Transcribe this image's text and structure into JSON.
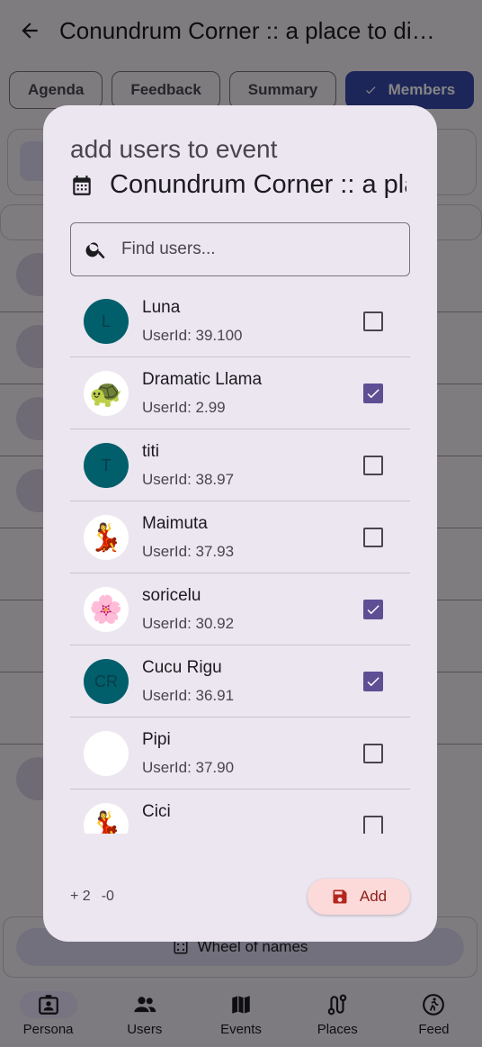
{
  "appbar": {
    "title": "Conundrum Corner :: a place to discuss"
  },
  "tabs": [
    {
      "label": "Agenda",
      "active": false
    },
    {
      "label": "Feedback",
      "active": false
    },
    {
      "label": "Summary",
      "active": false
    },
    {
      "label": "Members",
      "active": true
    }
  ],
  "background": {
    "wheel_label": "Wheel of names"
  },
  "nav": [
    {
      "label": "Persona",
      "icon": "persona-icon",
      "active": true
    },
    {
      "label": "Users",
      "icon": "users-icon",
      "active": false
    },
    {
      "label": "Events",
      "icon": "map-icon",
      "active": false
    },
    {
      "label": "Places",
      "icon": "route-icon",
      "active": false
    },
    {
      "label": "Feed",
      "icon": "run-icon",
      "active": false
    }
  ],
  "dialog": {
    "title": "add users to event",
    "subtitle": "Conundrum Corner :: a place to discuss",
    "search": {
      "placeholder": "Find users...",
      "value": ""
    },
    "users": [
      {
        "name": "Luna",
        "user_id": "UserId: 39.100",
        "avatar": "L",
        "checked": false
      },
      {
        "name": "Dramatic Llama",
        "user_id": "UserId: 2.99",
        "avatar": "🐢",
        "checked": true
      },
      {
        "name": "titi",
        "user_id": "UserId: 38.97",
        "avatar": "T",
        "checked": false
      },
      {
        "name": "Maimuta",
        "user_id": "UserId: 37.93",
        "avatar": "💃",
        "checked": false
      },
      {
        "name": "soricelu",
        "user_id": "UserId: 30.92",
        "avatar": "🌸",
        "checked": true
      },
      {
        "name": "Cucu Rigu",
        "user_id": "UserId: 36.91",
        "avatar": "CR",
        "checked": true
      },
      {
        "name": "Pipi",
        "user_id": "UserId: 37.90",
        "avatar": "",
        "checked": false
      },
      {
        "name": "Cici",
        "user_id": "",
        "avatar": "💃",
        "checked": false
      }
    ],
    "added_count": "+ 2",
    "removed_count": "-0",
    "add_label": "Add"
  },
  "colors": {
    "accent": "#5e4e94",
    "members_tab": "#3949ab",
    "add_button_bg": "#fcdada",
    "add_button_fg": "#8c1d18",
    "avatar_initials_bg": "#005f6b"
  }
}
